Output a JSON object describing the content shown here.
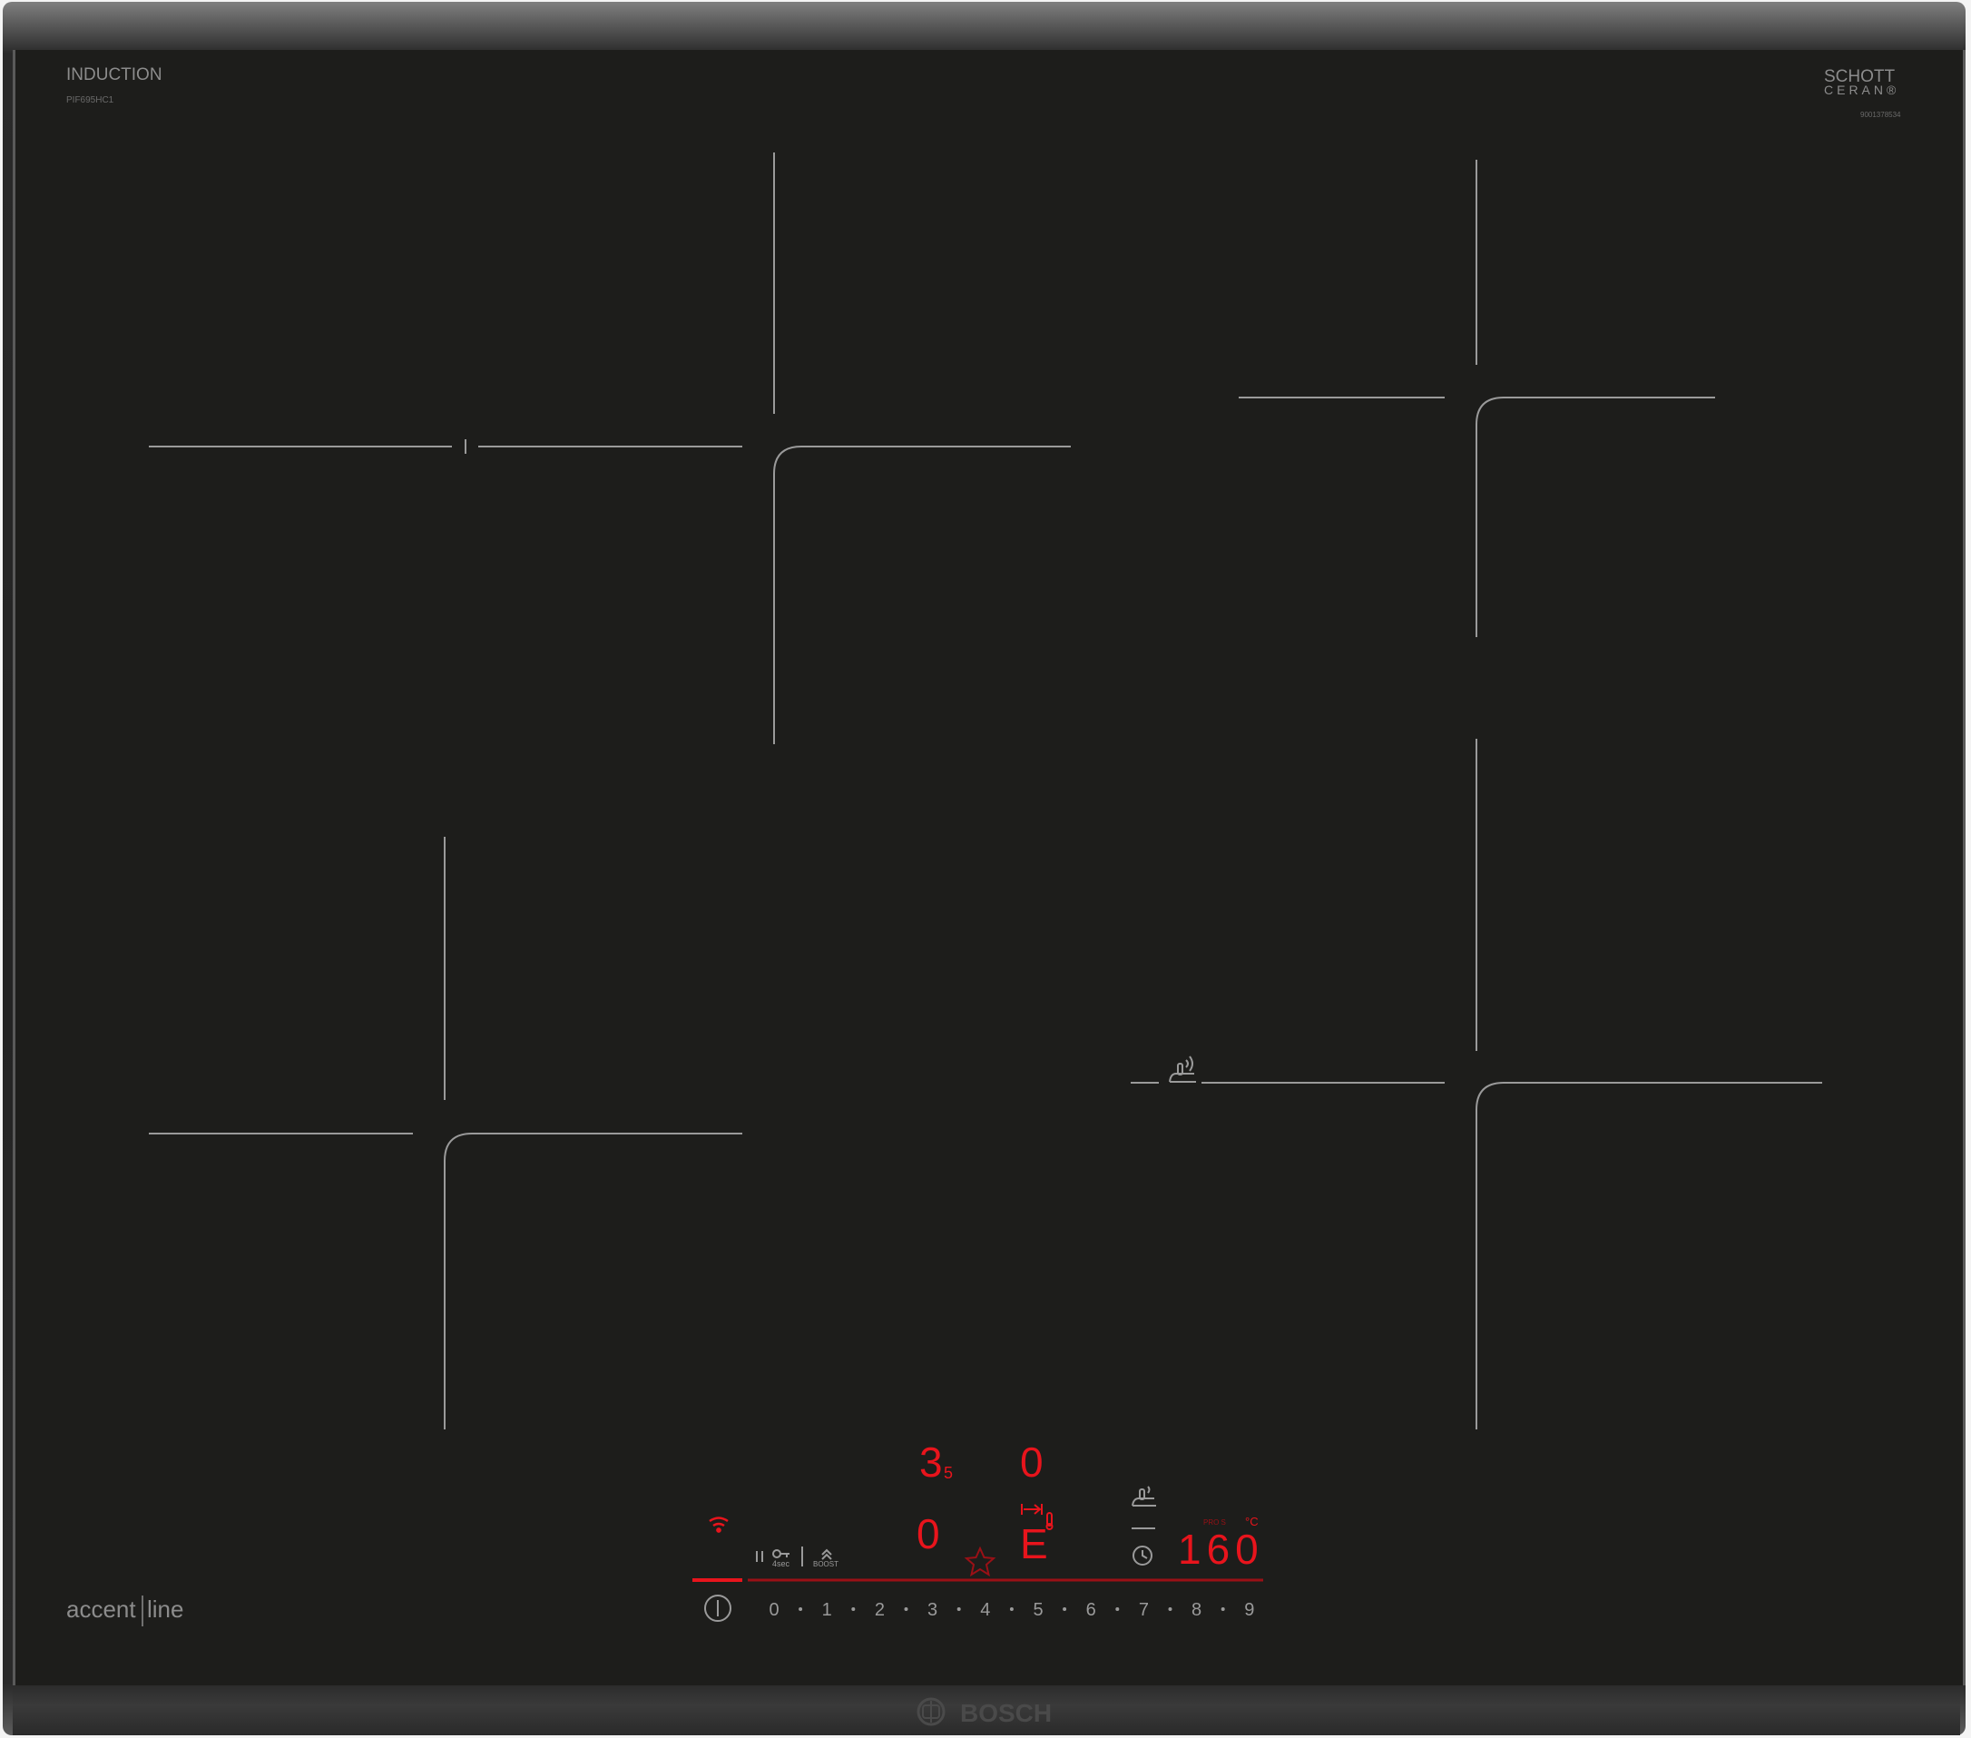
{
  "app": {
    "type_label": "INDUCTION",
    "model_number": "PIF695HC1",
    "glass_brand_line1": "SCHOTT",
    "glass_brand_line2": "CERAN®",
    "glass_code": "9001378534",
    "series_part1": "accent",
    "series_part2": "line",
    "manufacturer": "BOSCH"
  },
  "colors": {
    "glass": "#1d1d1b",
    "zone_line": "#9a9a9a",
    "display_red": "#e8141c",
    "label_grey": "#8c8c8c"
  },
  "display": {
    "zone_rear_left_level": "3",
    "zone_rear_left_residual": "5",
    "zone_rear_right_level": "0",
    "zone_front_left_level": "0",
    "zone_front_right_level": "E",
    "frying_temp_value": "160",
    "temp_unit": "°C",
    "frying_caption": "PRO S"
  },
  "controls": {
    "lock_hint": "4sec",
    "boost_label": "BOOST",
    "slider_values": [
      "0",
      "1",
      "2",
      "3",
      "4",
      "5",
      "6",
      "7",
      "8",
      "9"
    ]
  },
  "icons": {
    "wifi": "wifi-icon",
    "power": "power-icon",
    "pause": "pause-icon",
    "child_lock": "key-icon",
    "boost": "boost-icon",
    "favourite": "star-icon",
    "move": "move-arrow-icon",
    "sensor": "thermometer-icon",
    "frying_sensor": "pan-sensor-icon",
    "timer": "clock-icon"
  }
}
